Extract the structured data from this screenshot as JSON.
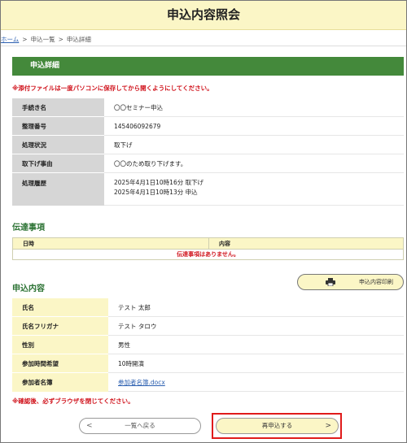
{
  "header": {
    "title": "申込内容照会"
  },
  "breadcrumb": {
    "home": "ホーム",
    "list": "申込一覧",
    "detail": "申込詳細",
    "separator": ">"
  },
  "detail_section": {
    "title": "申込詳細",
    "notice": "※添付ファイルは一度パソコンに保存してから開くようにしてください。",
    "rows": {
      "procedure_name": {
        "label": "手続き名",
        "value": "〇〇セミナー申込"
      },
      "reference_no": {
        "label": "整理番号",
        "value": "145406092679"
      },
      "status": {
        "label": "処理状況",
        "value": "取下げ"
      },
      "withdraw_reason": {
        "label": "取下げ事由",
        "value": "〇〇のため取り下げます。"
      },
      "history": {
        "label": "処理履歴",
        "line1": "2025年4月1日10時16分 取下げ",
        "line2": "2025年4月1日10時13分 申込"
      }
    }
  },
  "messages": {
    "title": "伝達事項",
    "col_date": "日時",
    "col_content": "内容",
    "empty": "伝達事項はありません。"
  },
  "application": {
    "title": "申込内容",
    "print_label": "申込内容印刷",
    "rows": {
      "name": {
        "label": "氏名",
        "value": "テスト 太郎"
      },
      "kana": {
        "label": "氏名フリガナ",
        "value": "テスト タロウ"
      },
      "gender": {
        "label": "性別",
        "value": "男性"
      },
      "time": {
        "label": "参加時間希望",
        "value": "10時開演"
      },
      "list": {
        "label": "参加者名簿",
        "value": "参加者名簿.docx"
      }
    },
    "notice": "※確認後、必ずブラウザを閉じてください。"
  },
  "footer": {
    "back_label": "一覧へ戻る",
    "reapply_label": "再申込する",
    "back_arrow": "<",
    "reapply_arrow": ">"
  },
  "colors": {
    "accent_green": "#44893b",
    "header_yellow": "#fbf6c6",
    "notice_red": "#d0121b",
    "highlight_red": "#e01b1b"
  }
}
